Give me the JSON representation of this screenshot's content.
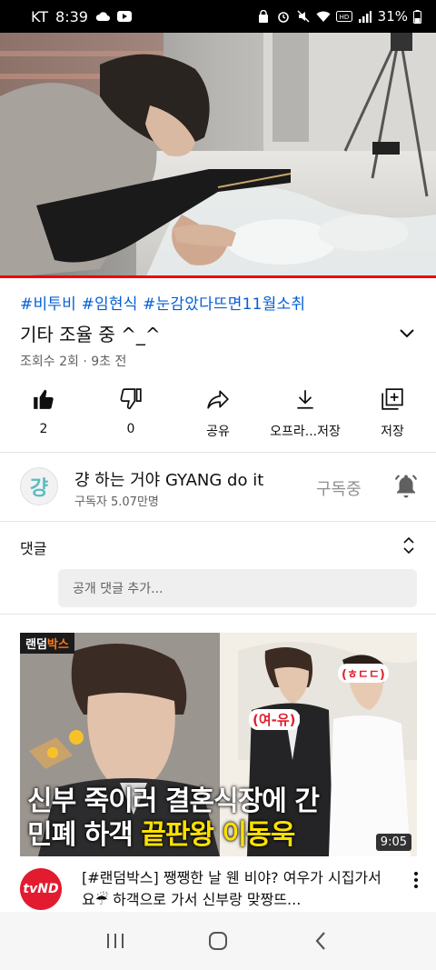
{
  "status_bar": {
    "carrier": "KT",
    "time": "8:39",
    "battery": "31%",
    "icons": [
      "cloud-icon",
      "youtube-icon",
      "alarm-icon",
      "mute-icon",
      "wifi-icon",
      "hd-icon",
      "signal-icon",
      "battery-icon"
    ]
  },
  "video": {
    "progress": 0.0
  },
  "meta": {
    "hashtags": "#비투비 #임현식 #눈감았다뜨면11월소취",
    "title": "기타 조율 중 ^_^",
    "views": "조회수 2회 · 9초 전"
  },
  "actions": [
    {
      "icon": "like-icon",
      "label": "2"
    },
    {
      "icon": "dislike-icon",
      "label": "0"
    },
    {
      "icon": "share-icon",
      "label": "공유"
    },
    {
      "icon": "download-icon",
      "label": "오프라...저장"
    },
    {
      "icon": "save-icon",
      "label": "저장"
    }
  ],
  "channel": {
    "avatar_text": "걍",
    "name": "걍 하는 거야 GYANG do it",
    "subscribers": "구독자 5.07만명",
    "subscribe_label": "구독중"
  },
  "comments": {
    "title": "댓글",
    "placeholder": "공개 댓글 추가..."
  },
  "recommended": {
    "badge_a": "랜덤",
    "badge_b": "박스",
    "caption_line1": "신부 죽이러 결혼식장에 간",
    "caption_line2a": "민폐 하객 ",
    "caption_line2b": "끝판왕 이동욱",
    "sticker_left": "(여-유)",
    "sticker_right": "(ㅎㄷㄷ)",
    "duration": "9:05",
    "channel_logo": "tvND",
    "title": "[#랜덤박스] 쨍쨍한 날 웬 비야? 여우가 시집가서요☔ 하객으로 가서 신부랑 맞짱뜨..."
  },
  "colors": {
    "link": "#065fd4",
    "progress": "#ee0000",
    "tvnd": "#e21b30"
  }
}
